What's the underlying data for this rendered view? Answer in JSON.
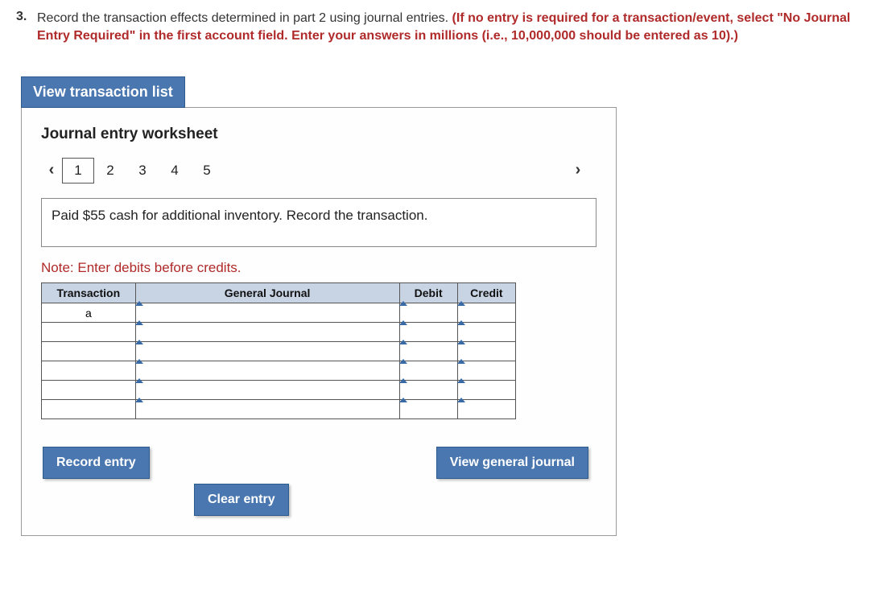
{
  "question": {
    "number": "3.",
    "text_part1": "Record the transaction effects determined in part 2 using journal entries. ",
    "text_part2": "(If no entry is required for a transaction/event, select \"No Journal Entry Required\" in the first account field. Enter your answers in millions (i.e., 10,000,000 should be entered as 10).)"
  },
  "view_transaction_button": "View transaction list",
  "worksheet": {
    "title": "Journal entry worksheet",
    "pages": [
      "1",
      "2",
      "3",
      "4",
      "5"
    ],
    "active_page": "1",
    "description": "Paid $55 cash for additional inventory. Record the transaction.",
    "note": "Note: Enter debits before credits.",
    "headers": {
      "transaction": "Transaction",
      "general_journal": "General Journal",
      "debit": "Debit",
      "credit": "Credit"
    },
    "rows": [
      {
        "transaction": "a",
        "gj": "",
        "debit": "",
        "credit": ""
      },
      {
        "transaction": "",
        "gj": "",
        "debit": "",
        "credit": ""
      },
      {
        "transaction": "",
        "gj": "",
        "debit": "",
        "credit": ""
      },
      {
        "transaction": "",
        "gj": "",
        "debit": "",
        "credit": ""
      },
      {
        "transaction": "",
        "gj": "",
        "debit": "",
        "credit": ""
      },
      {
        "transaction": "",
        "gj": "",
        "debit": "",
        "credit": ""
      }
    ],
    "buttons": {
      "record": "Record entry",
      "clear": "Clear entry",
      "view_general_journal": "View general journal"
    }
  }
}
